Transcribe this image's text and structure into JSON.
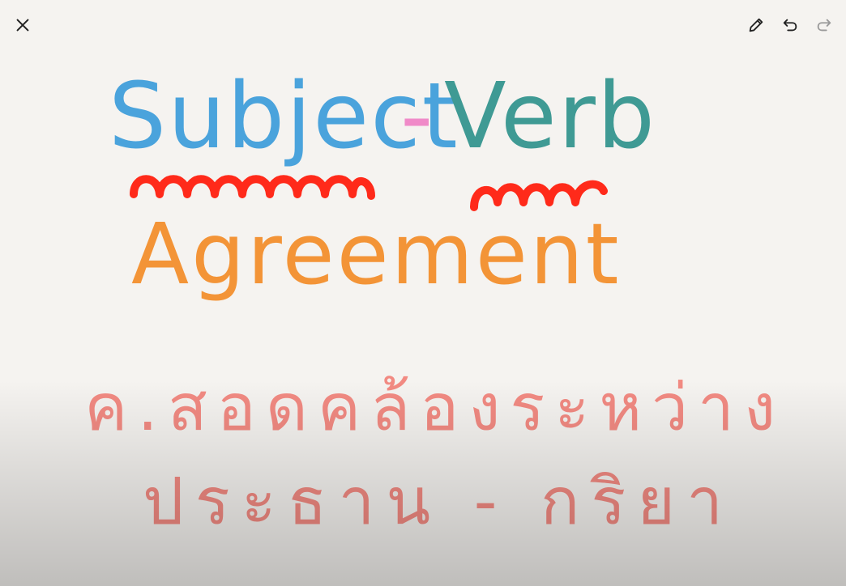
{
  "toolbar": {
    "close_icon": "close-icon",
    "pencil_icon": "pencil-icon",
    "undo_icon": "undo-icon",
    "redo_icon": "redo-icon"
  },
  "drawing": {
    "title_word1": "Subject",
    "title_dash": "-",
    "title_word2": "Verb",
    "subtitle": "Agreement",
    "thai_line1": "ค.สอดคล้องระหว่าง",
    "thai_line2": "ประธาน - กริยา"
  },
  "colors": {
    "subject": "#4aa3dc",
    "dash": "#f08ac8",
    "verb": "#3f9a94",
    "agreement": "#f39437",
    "squiggle": "#ff2a1a",
    "thai": "#f28a82",
    "icon": "#222222",
    "icon_disabled": "#9a9a9a"
  }
}
